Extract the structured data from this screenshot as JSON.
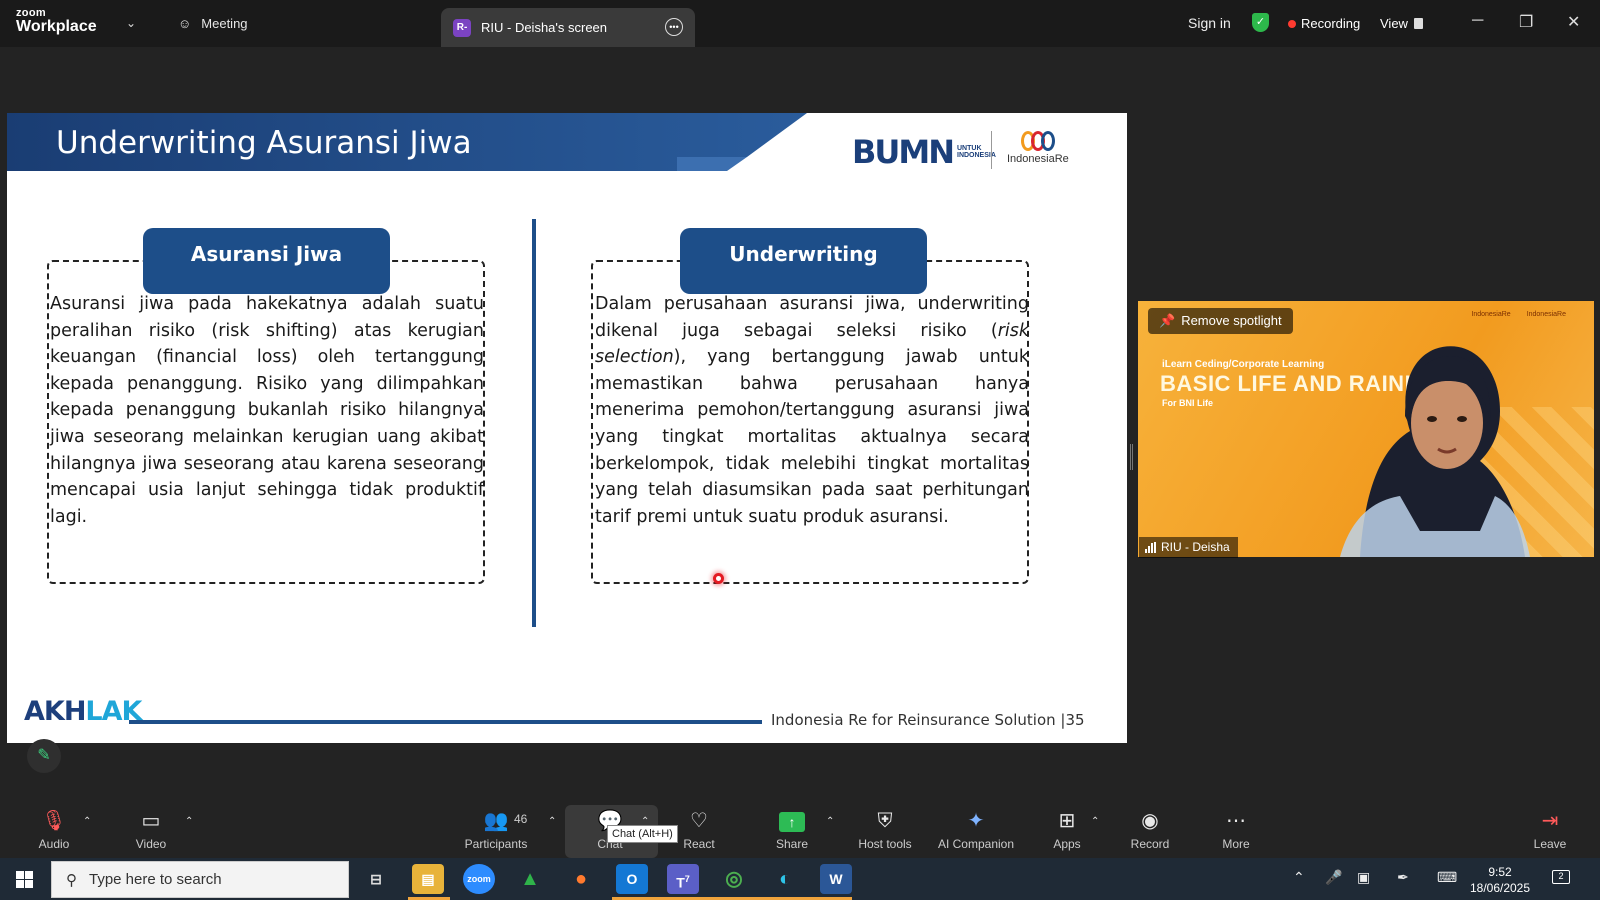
{
  "app": {
    "brand_top": "zoom",
    "brand_bottom": "Workplace"
  },
  "titlebar": {
    "meeting_label": "Meeting",
    "tab_badge": "R-",
    "tab_label": "RIU - Deisha's screen",
    "sign_in": "Sign in",
    "recording": "Recording",
    "view": "View",
    "window_controls": [
      "minimize-icon",
      "restore-icon",
      "close-icon"
    ]
  },
  "slide": {
    "title": "Underwriting Asuransi Jiwa",
    "bumn_logo": "BUMN",
    "bumn_sub1": "UNTUK",
    "bumn_sub2": "INDONESIA",
    "partner_logo": "IndonesiaRe",
    "left_header": "Asuransi Jiwa",
    "left_text": "Asuransi jiwa pada hakekatnya adalah suatu peralihan risiko (risk shifting) atas kerugian keuangan (financial loss) oleh tertanggung kepada penanggung. Risiko yang dilimpahkan kepada penanggung bukanlah risiko hilangnya jiwa seseorang melainkan kerugian uang akibat hilangnya jiwa seseorang atau karena seseorang mencapai usia lanjut sehingga tidak produktif lagi.",
    "right_header": "Underwriting",
    "right_text_a": "Dalam perusahaan asuransi jiwa, underwriting dikenal juga sebagai seleksi risiko (",
    "right_text_em": "risk selection",
    "right_text_b": "), yang bertanggung jawab untuk memastikan bahwa perusahaan hanya menerima pemohon/tertanggung asuransi jiwa yang tingkat mortalitas aktualnya secara berkelompok, tidak melebihi tingkat mortalitas yang telah diasumsikan pada saat perhitungan tarif premi untuk suatu produk asuransi.",
    "footer_logo_a": "AKH",
    "footer_logo_b": "LAK",
    "footer_text": "Indonesia Re for Reinsurance Solution  |35"
  },
  "video_tile": {
    "spotlight_button": "Remove spotlight",
    "participant_name": "RIU - Deisha",
    "bg_title_small": "iLearn Ceding/Corporate Learning",
    "bg_title_big": "BASIC LIFE AND       RAINING",
    "bg_sub": "For BNI Life",
    "bg_logo_1": "IndonesiaRe",
    "bg_logo_2": "IndonesiaRe"
  },
  "toolbar": {
    "audio": "Audio",
    "video": "Video",
    "participants": "Participants",
    "participant_count": "46",
    "chat": "Chat",
    "chat_tooltip": "Chat (Alt+H)",
    "react": "React",
    "share": "Share",
    "host_tools": "Host tools",
    "ai_companion": "AI Companion",
    "apps": "Apps",
    "record": "Record",
    "more": "More",
    "leave": "Leave"
  },
  "taskbar": {
    "search_placeholder": "Type here to search",
    "time": "9:52",
    "date": "18/06/2025",
    "notification_count": "2",
    "teams_badge": "7"
  },
  "colors": {
    "slide_blue": "#1d4e89",
    "recording_red": "#ff3b30",
    "share_green": "#2dbb55",
    "tile_orange": "#f4a82b"
  }
}
